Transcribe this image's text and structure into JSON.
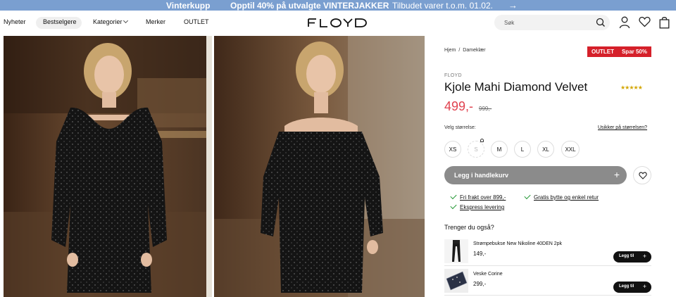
{
  "promo": {
    "part1": "Vinterkupp",
    "part2": "Opptil 40% på utvalgte VINTERJAKKER",
    "part3": "Tilbudet varer t.o.m. 01.02.",
    "arrow": "→"
  },
  "nav": {
    "items": [
      "Nyheter",
      "Bestselgere",
      "Kategorier",
      "Merker",
      "OUTLET"
    ],
    "active": "Bestselgere"
  },
  "logo": "FLOYD",
  "search": {
    "placeholder": "Søk"
  },
  "header_icons": [
    "search-icon",
    "user-icon",
    "heart-icon",
    "bag-icon"
  ],
  "breadcrumb": [
    "Hjem",
    "Dameklær"
  ],
  "badge": {
    "label": "OUTLET",
    "discount": "Spar 50%",
    "color": "#d5202a"
  },
  "product": {
    "brand": "FLOYD",
    "name": "Kjole Mahi Diamond Velvet",
    "rating_stars": 5,
    "stars_text": "★★★★★",
    "price": "499,-",
    "old_price": "999,-",
    "price_color": "#e0424f"
  },
  "sizes": {
    "label": "Velg størrelse:",
    "help_link": "Usikker på størrelsen?",
    "options": [
      "XS",
      "S",
      "M",
      "L",
      "XL",
      "XXL"
    ],
    "unavailable": [
      "S"
    ]
  },
  "actions": {
    "add_to_cart": "Legg i handlekurv",
    "plus": "+"
  },
  "usps": [
    "Fri frakt over 899,-",
    "Gratis bytte og enkel retur",
    "Ekspress levering"
  ],
  "recommendations": {
    "title": "Trenger du også?",
    "items": [
      {
        "name": "Strømpebukse New Nikoline 40DEN 2pk",
        "price": "149,-",
        "button": "Legg til"
      },
      {
        "name": "Veske Corine",
        "price": "299,-",
        "button": "Legg til"
      }
    ]
  }
}
